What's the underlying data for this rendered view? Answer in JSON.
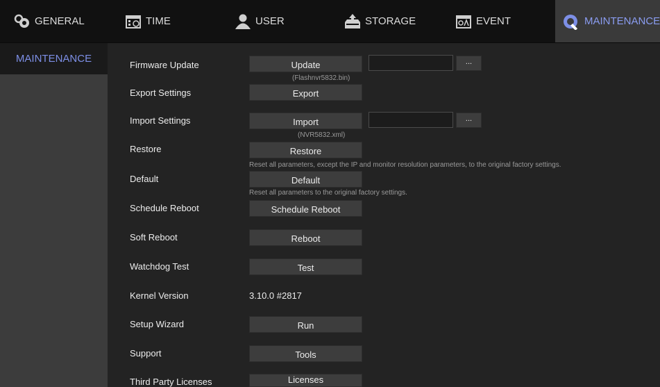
{
  "tabs": [
    {
      "label": "GENERAL",
      "icon": "gear-icon"
    },
    {
      "label": "TIME",
      "icon": "calendar-clock-icon"
    },
    {
      "label": "USER",
      "icon": "user-icon"
    },
    {
      "label": "STORAGE",
      "icon": "storage-icon"
    },
    {
      "label": "EVENT",
      "icon": "event-calendar-icon"
    },
    {
      "label": "MAINTENANCE",
      "icon": "maintenance-icon",
      "active": true
    }
  ],
  "sidebar": {
    "items": [
      {
        "label": "MAINTENANCE",
        "active": true
      }
    ]
  },
  "main": {
    "firmware_update": {
      "label": "Firmware Update",
      "button": "Update",
      "hint": "(Flashnvr5832.bin)",
      "file_value": "",
      "browse": "..."
    },
    "export_settings": {
      "label": "Export Settings",
      "button": "Export"
    },
    "import_settings": {
      "label": "Import Settings",
      "button": "Import",
      "hint": "(NVR5832.xml)",
      "file_value": "",
      "browse": "..."
    },
    "restore": {
      "label": "Restore",
      "button": "Restore",
      "hint": "Reset all parameters, except the IP and monitor resolution parameters, to the original factory settings."
    },
    "default": {
      "label": "Default",
      "button": "Default",
      "hint": "Reset all parameters to the original factory settings."
    },
    "schedule_reboot": {
      "label": "Schedule Reboot",
      "button": "Schedule Reboot"
    },
    "soft_reboot": {
      "label": "Soft Reboot",
      "button": "Reboot"
    },
    "watchdog_test": {
      "label": "Watchdog Test",
      "button": "Test"
    },
    "kernel_version": {
      "label": "Kernel Version",
      "value": "3.10.0 #2817"
    },
    "setup_wizard": {
      "label": "Setup Wizard",
      "button": "Run"
    },
    "support": {
      "label": "Support",
      "button": "Tools"
    },
    "third_party": {
      "label": "Third Party Licenses",
      "button": "Licenses"
    }
  },
  "colors": {
    "active_tab_text": "#8a9cf0",
    "background": "#232323",
    "sidebar": "#3c3c3c",
    "button": "#3d3d3d"
  }
}
